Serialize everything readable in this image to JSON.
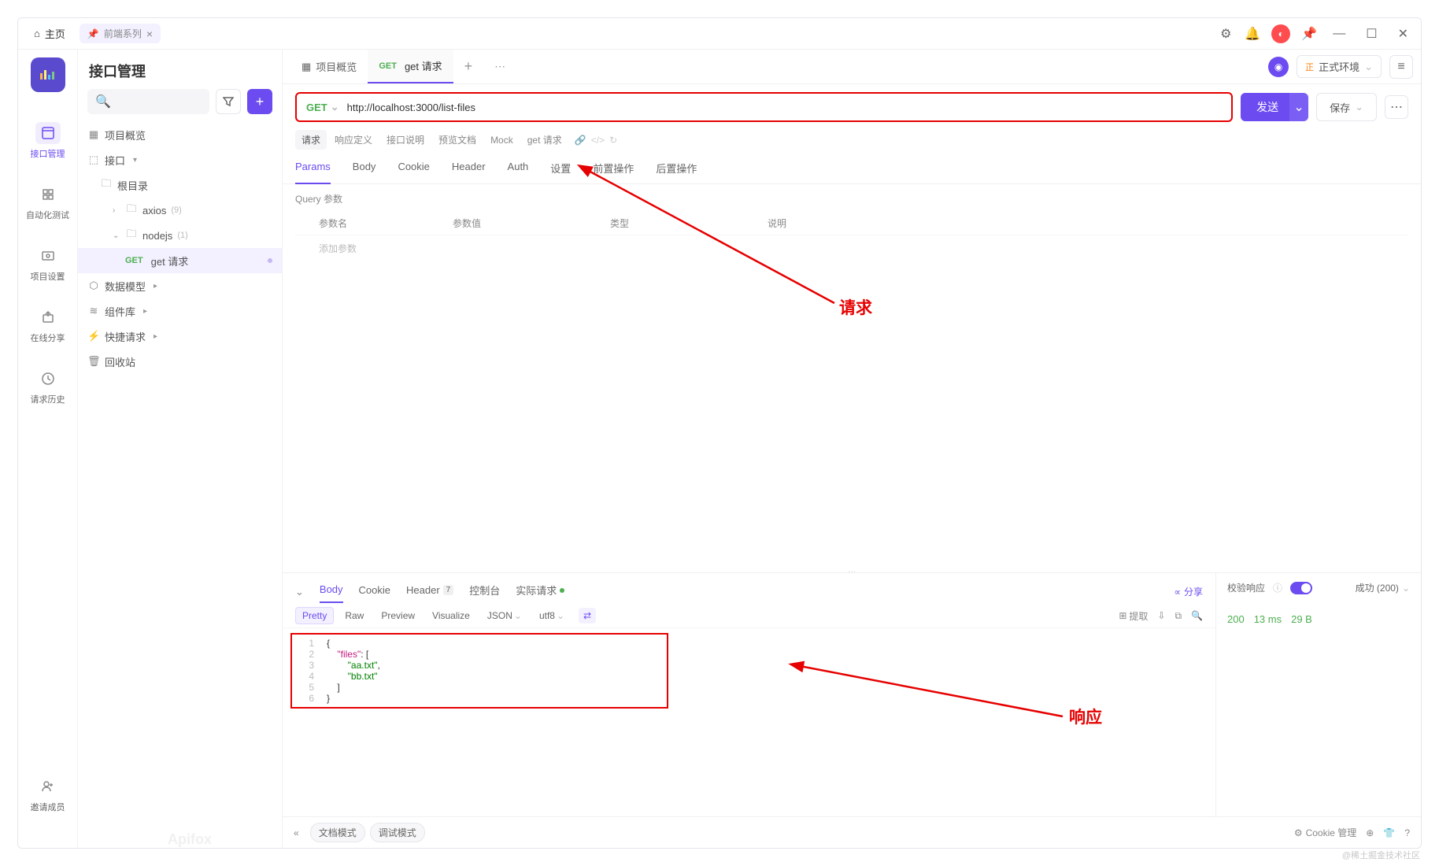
{
  "titlebar": {
    "home": "主页",
    "tab_label": "前端系列"
  },
  "rail": {
    "items": [
      {
        "label": "接口管理"
      },
      {
        "label": "自动化测试"
      },
      {
        "label": "项目设置"
      },
      {
        "label": "在线分享"
      },
      {
        "label": "请求历史"
      }
    ],
    "invite": "邀请成员"
  },
  "sidebar": {
    "title": "接口管理",
    "overview": "项目概览",
    "interface": "接口",
    "root_dir": "根目录",
    "axios": "axios",
    "axios_count": "(9)",
    "nodejs": "nodejs",
    "nodejs_count": "(1)",
    "get_method": "GET",
    "get_name": "get 请求",
    "data_model": "数据模型",
    "component": "组件库",
    "quick_req": "快捷请求",
    "recycle": "回收站"
  },
  "tabs": {
    "overview": "项目概览",
    "get_method": "GET",
    "get_name": "get 请求"
  },
  "env": {
    "badge": "正",
    "label": "正式环境"
  },
  "url_bar": {
    "method": "GET",
    "url": "http://localhost:3000/list-files",
    "send": "发送",
    "save": "保存"
  },
  "subtabs": [
    "请求",
    "响应定义",
    "接口说明",
    "预览文档",
    "Mock",
    "get 请求"
  ],
  "req_tabs": [
    "Params",
    "Body",
    "Cookie",
    "Header",
    "Auth",
    "设置",
    "前置操作",
    "后置操作"
  ],
  "query": {
    "title": "Query 参数",
    "cols": [
      "参数名",
      "参数值",
      "类型",
      "说明"
    ],
    "add": "添加参数"
  },
  "resp_tabs": {
    "body": "Body",
    "cookie": "Cookie",
    "header": "Header",
    "header_count": "7",
    "console": "控制台",
    "actual": "实际请求",
    "share": "分享"
  },
  "fmt": {
    "pretty": "Pretty",
    "raw": "Raw",
    "preview": "Preview",
    "visualize": "Visualize",
    "json": "JSON",
    "utf8": "utf8",
    "extract": "提取"
  },
  "json_lines": [
    {
      "n": "1",
      "content": [
        {
          "t": "p",
          "v": "{"
        }
      ]
    },
    {
      "n": "2",
      "content": [
        {
          "t": "indent",
          "v": 1
        },
        {
          "t": "k",
          "v": "\"files\""
        },
        {
          "t": "p",
          "v": ": ["
        }
      ]
    },
    {
      "n": "3",
      "content": [
        {
          "t": "indent",
          "v": 2
        },
        {
          "t": "s",
          "v": "\"aa.txt\""
        },
        {
          "t": "p",
          "v": ","
        }
      ]
    },
    {
      "n": "4",
      "content": [
        {
          "t": "indent",
          "v": 2
        },
        {
          "t": "s",
          "v": "\"bb.txt\""
        }
      ]
    },
    {
      "n": "5",
      "content": [
        {
          "t": "indent",
          "v": 1
        },
        {
          "t": "p",
          "v": "]"
        }
      ]
    },
    {
      "n": "6",
      "content": [
        {
          "t": "p",
          "v": "}"
        }
      ]
    }
  ],
  "resp_side": {
    "verify": "校验响应",
    "success": "成功 (200)",
    "code": "200",
    "time": "13 ms",
    "size": "29 B"
  },
  "footer": {
    "doc_mode": "文档模式",
    "debug_mode": "调试模式",
    "cookie": "Cookie 管理"
  },
  "annotations": {
    "request": "请求",
    "response": "响应"
  },
  "watermark": "Apifox",
  "attribution": "@稀土掘金技术社区"
}
